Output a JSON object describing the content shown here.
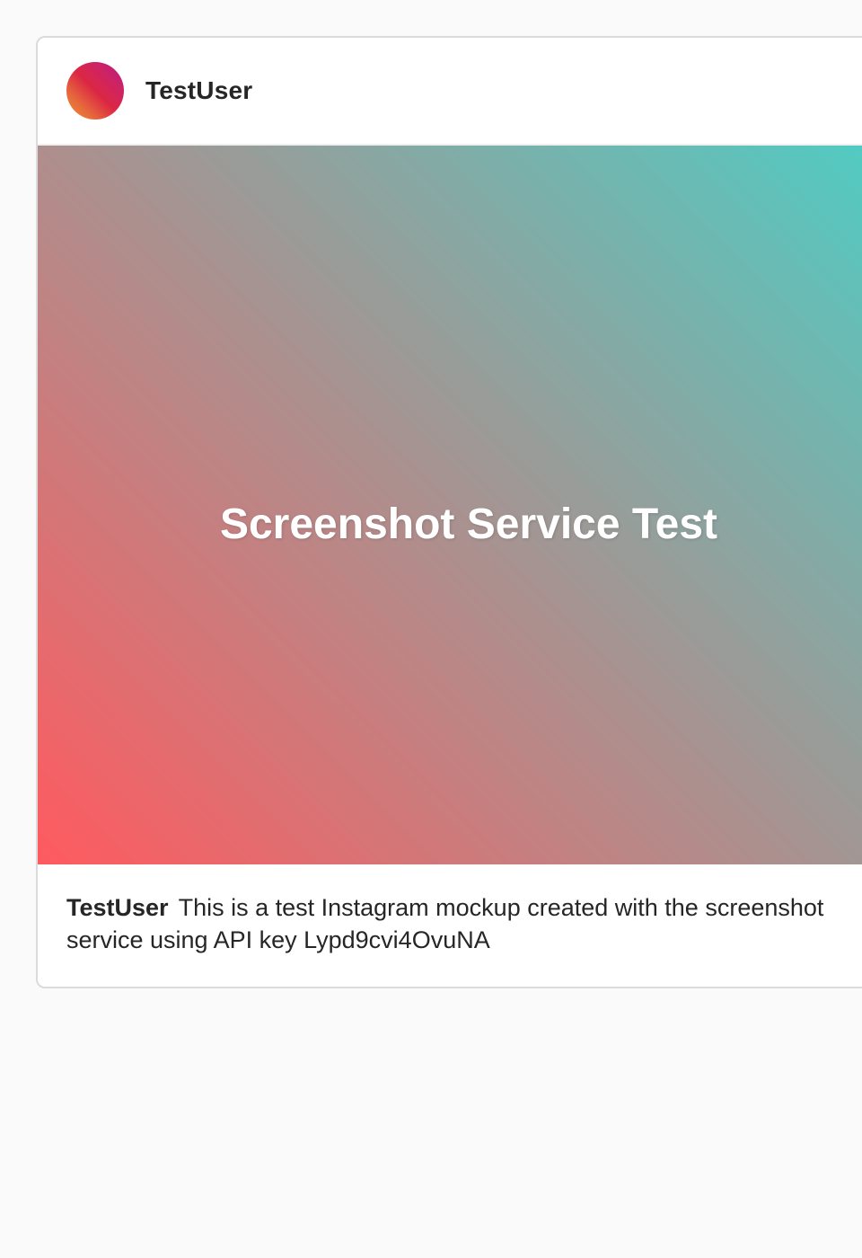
{
  "post": {
    "username": "TestUser",
    "image_text": "Screenshot Service Test",
    "caption_user": "TestUser",
    "caption_text": "This is a test Instagram mockup created with the screenshot service using API key Lypd9cvi4OvuNA"
  },
  "colors": {
    "page_background": "#fafafa",
    "card_background": "#ffffff",
    "card_border": "#dbdbdb",
    "gradient_start": "#ff5a5f",
    "gradient_end": "#4ecdc4",
    "avatar_gradient": [
      "#f09433",
      "#dc2743",
      "#bc1888"
    ],
    "text_primary": "#262626"
  }
}
